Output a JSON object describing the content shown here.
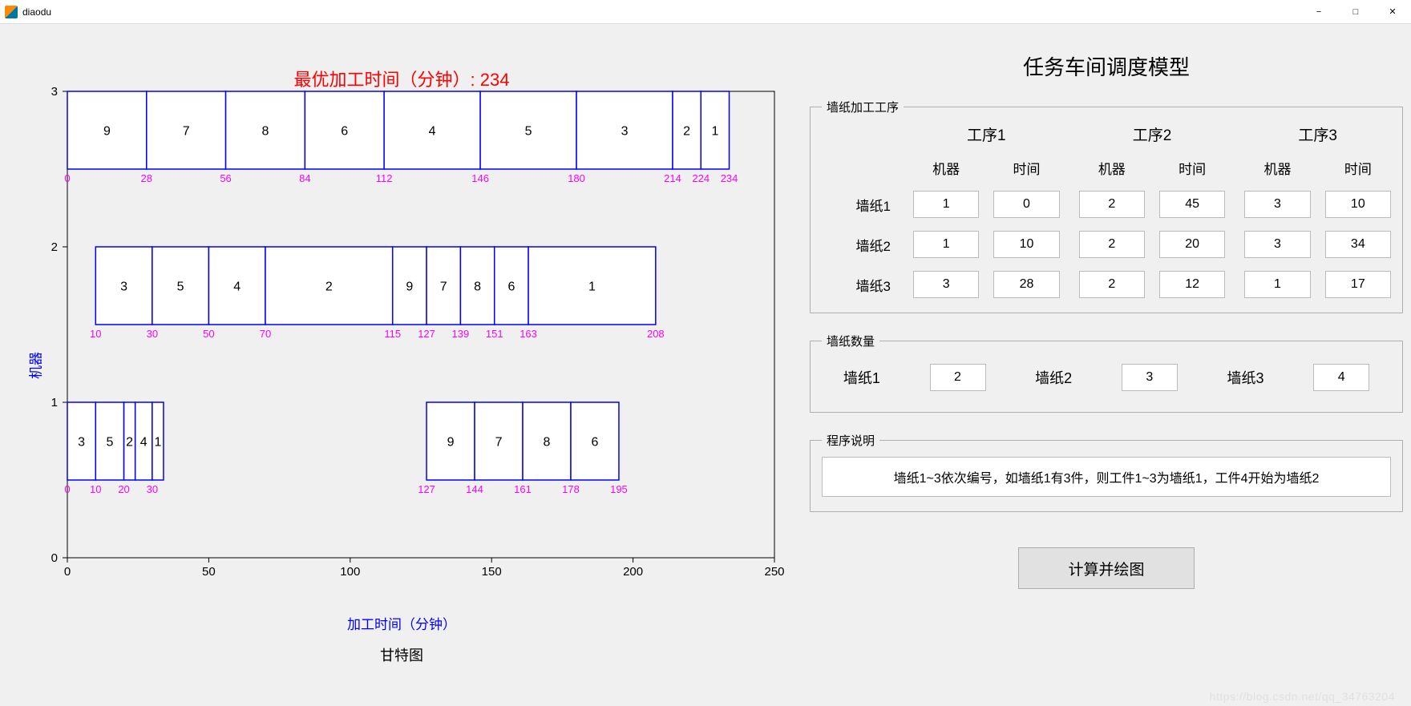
{
  "window": {
    "title": "diaodu"
  },
  "chart_data": {
    "type": "bar",
    "title": "最优加工时间（分钟）: 234",
    "xlabel": "加工时间（分钟）",
    "ylabel": "机器",
    "subtitle": "甘特图",
    "xrange": [
      0,
      250
    ],
    "machines": [
      1,
      2,
      3
    ],
    "xticks": [
      0,
      50,
      100,
      150,
      200,
      250
    ],
    "bars": [
      {
        "machine": 3,
        "start": 0,
        "end": 28,
        "job": "9"
      },
      {
        "machine": 3,
        "start": 28,
        "end": 56,
        "job": "7"
      },
      {
        "machine": 3,
        "start": 56,
        "end": 84,
        "job": "8"
      },
      {
        "machine": 3,
        "start": 84,
        "end": 112,
        "job": "6"
      },
      {
        "machine": 3,
        "start": 112,
        "end": 146,
        "job": "4"
      },
      {
        "machine": 3,
        "start": 146,
        "end": 180,
        "job": "5"
      },
      {
        "machine": 3,
        "start": 180,
        "end": 214,
        "job": "3"
      },
      {
        "machine": 3,
        "start": 214,
        "end": 224,
        "job": "2"
      },
      {
        "machine": 3,
        "start": 224,
        "end": 234,
        "job": "1"
      },
      {
        "machine": 2,
        "start": 10,
        "end": 30,
        "job": "3"
      },
      {
        "machine": 2,
        "start": 30,
        "end": 50,
        "job": "5"
      },
      {
        "machine": 2,
        "start": 50,
        "end": 70,
        "job": "4"
      },
      {
        "machine": 2,
        "start": 70,
        "end": 115,
        "job": "2"
      },
      {
        "machine": 2,
        "start": 115,
        "end": 127,
        "job": "9"
      },
      {
        "machine": 2,
        "start": 127,
        "end": 139,
        "job": "7"
      },
      {
        "machine": 2,
        "start": 139,
        "end": 151,
        "job": "8"
      },
      {
        "machine": 2,
        "start": 151,
        "end": 163,
        "job": "6"
      },
      {
        "machine": 2,
        "start": 163,
        "end": 208,
        "job": "1"
      },
      {
        "machine": 1,
        "start": 0,
        "end": 10,
        "job": "3"
      },
      {
        "machine": 1,
        "start": 10,
        "end": 20,
        "job": "5"
      },
      {
        "machine": 1,
        "start": 20,
        "end": 24,
        "job": "2"
      },
      {
        "machine": 1,
        "start": 24,
        "end": 30,
        "job": "4"
      },
      {
        "machine": 1,
        "start": 30,
        "end": 34,
        "job": "1"
      },
      {
        "machine": 1,
        "start": 127,
        "end": 144,
        "job": "9"
      },
      {
        "machine": 1,
        "start": 144,
        "end": 161,
        "job": "7"
      },
      {
        "machine": 1,
        "start": 161,
        "end": 178,
        "job": "8"
      },
      {
        "machine": 1,
        "start": 178,
        "end": 195,
        "job": "6"
      }
    ],
    "annotations": {
      "3": [
        0,
        28,
        56,
        84,
        112,
        146,
        180,
        214,
        224,
        234
      ],
      "2": [
        10,
        30,
        50,
        70,
        115,
        127,
        139,
        151,
        163,
        208
      ],
      "1": [
        0,
        10,
        20,
        30,
        127,
        144,
        161,
        178,
        195
      ]
    }
  },
  "panel": {
    "main_heading": "任务车间调度模型",
    "group_process_title": "墙纸加工工序",
    "proc_headers": [
      "工序1",
      "工序2",
      "工序3"
    ],
    "sub_headers": {
      "machine": "机器",
      "time": "时间"
    },
    "rows": [
      {
        "label": "墙纸1",
        "vals": [
          "1",
          "0",
          "2",
          "45",
          "3",
          "10"
        ]
      },
      {
        "label": "墙纸2",
        "vals": [
          "1",
          "10",
          "2",
          "20",
          "3",
          "34"
        ]
      },
      {
        "label": "墙纸3",
        "vals": [
          "3",
          "28",
          "2",
          "12",
          "1",
          "17"
        ]
      }
    ],
    "group_qty_title": "墙纸数量",
    "qty": [
      {
        "label": "墙纸1",
        "value": "2"
      },
      {
        "label": "墙纸2",
        "value": "3"
      },
      {
        "label": "墙纸3",
        "value": "4"
      }
    ],
    "group_desc_title": "程序说明",
    "desc_text": "墙纸1~3依次编号，如墙纸1有3件，则工件1~3为墙纸1，工件4开始为墙纸2",
    "calc_button": "计算并绘图"
  }
}
